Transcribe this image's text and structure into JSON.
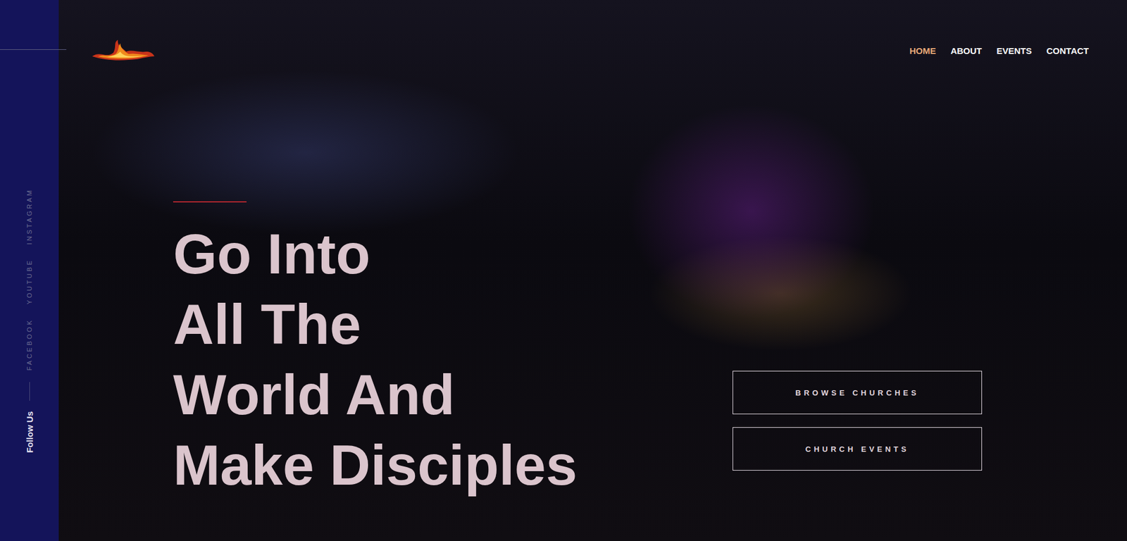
{
  "nav": [
    {
      "label": "HOME",
      "selected": true
    },
    {
      "label": "ABOUT",
      "selected": false
    },
    {
      "label": "EVENTS",
      "selected": false
    },
    {
      "label": "CONTACT",
      "selected": false
    }
  ],
  "social": {
    "title": "Follow Us",
    "links": [
      "INSTAGRAM",
      "YOUTUBE",
      "FACEBOOK"
    ]
  },
  "hero": {
    "headline": [
      "Go Into",
      "All The",
      "World And",
      "Make Disciples"
    ]
  },
  "buttons": [
    "BROWSE CHURCHES",
    "CHURCH EVENTS"
  ]
}
